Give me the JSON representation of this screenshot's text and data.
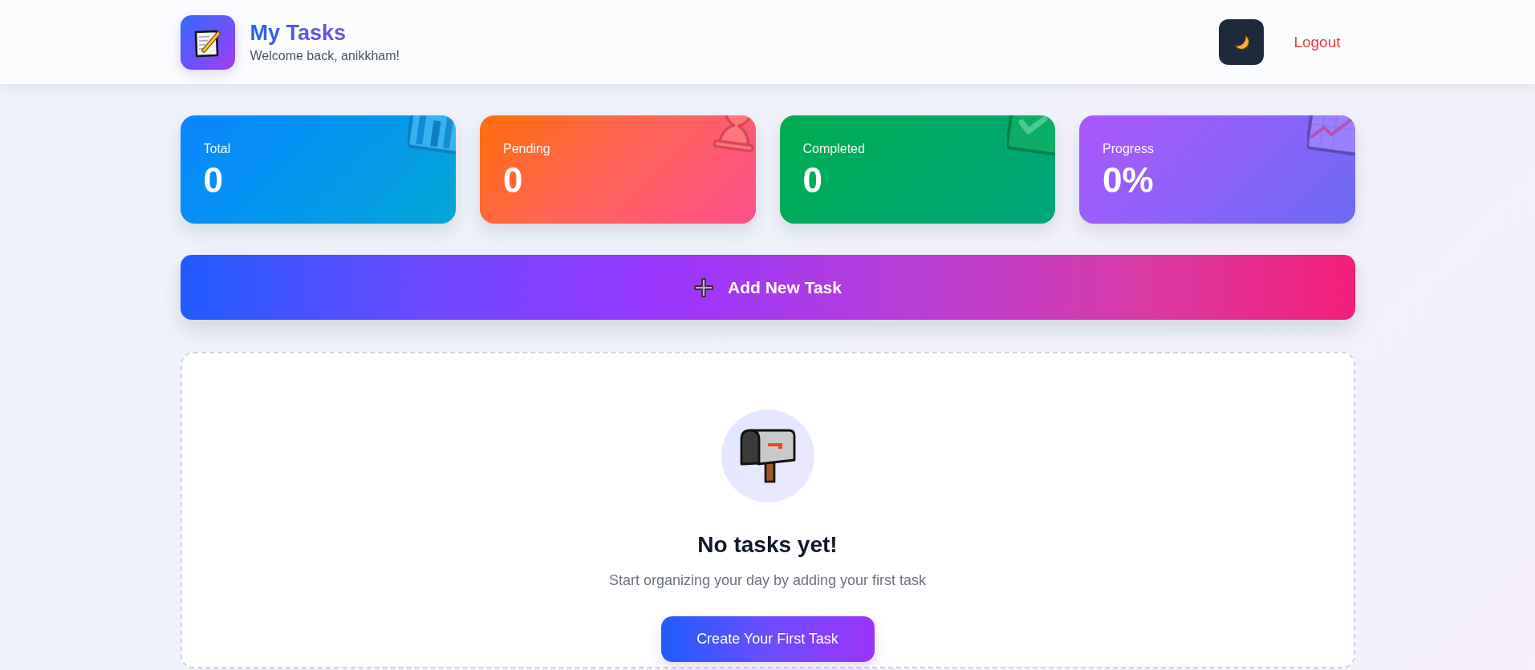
{
  "header": {
    "title": "My Tasks",
    "subtitle": "Welcome back, anikkham!",
    "logout": "Logout"
  },
  "stats": [
    {
      "kind": "bars",
      "label": "Total",
      "value": "0"
    },
    {
      "kind": "hourglass",
      "label": "Pending",
      "value": "0"
    },
    {
      "kind": "check",
      "label": "Completed",
      "value": "0"
    },
    {
      "kind": "trend",
      "label": "Progress",
      "value": "0%"
    }
  ],
  "add_button": {
    "label": "Add New Task"
  },
  "empty_state": {
    "title": "No tasks yet!",
    "message": "Start organizing your day by adding your first task",
    "button": "Create Your First Task"
  }
}
